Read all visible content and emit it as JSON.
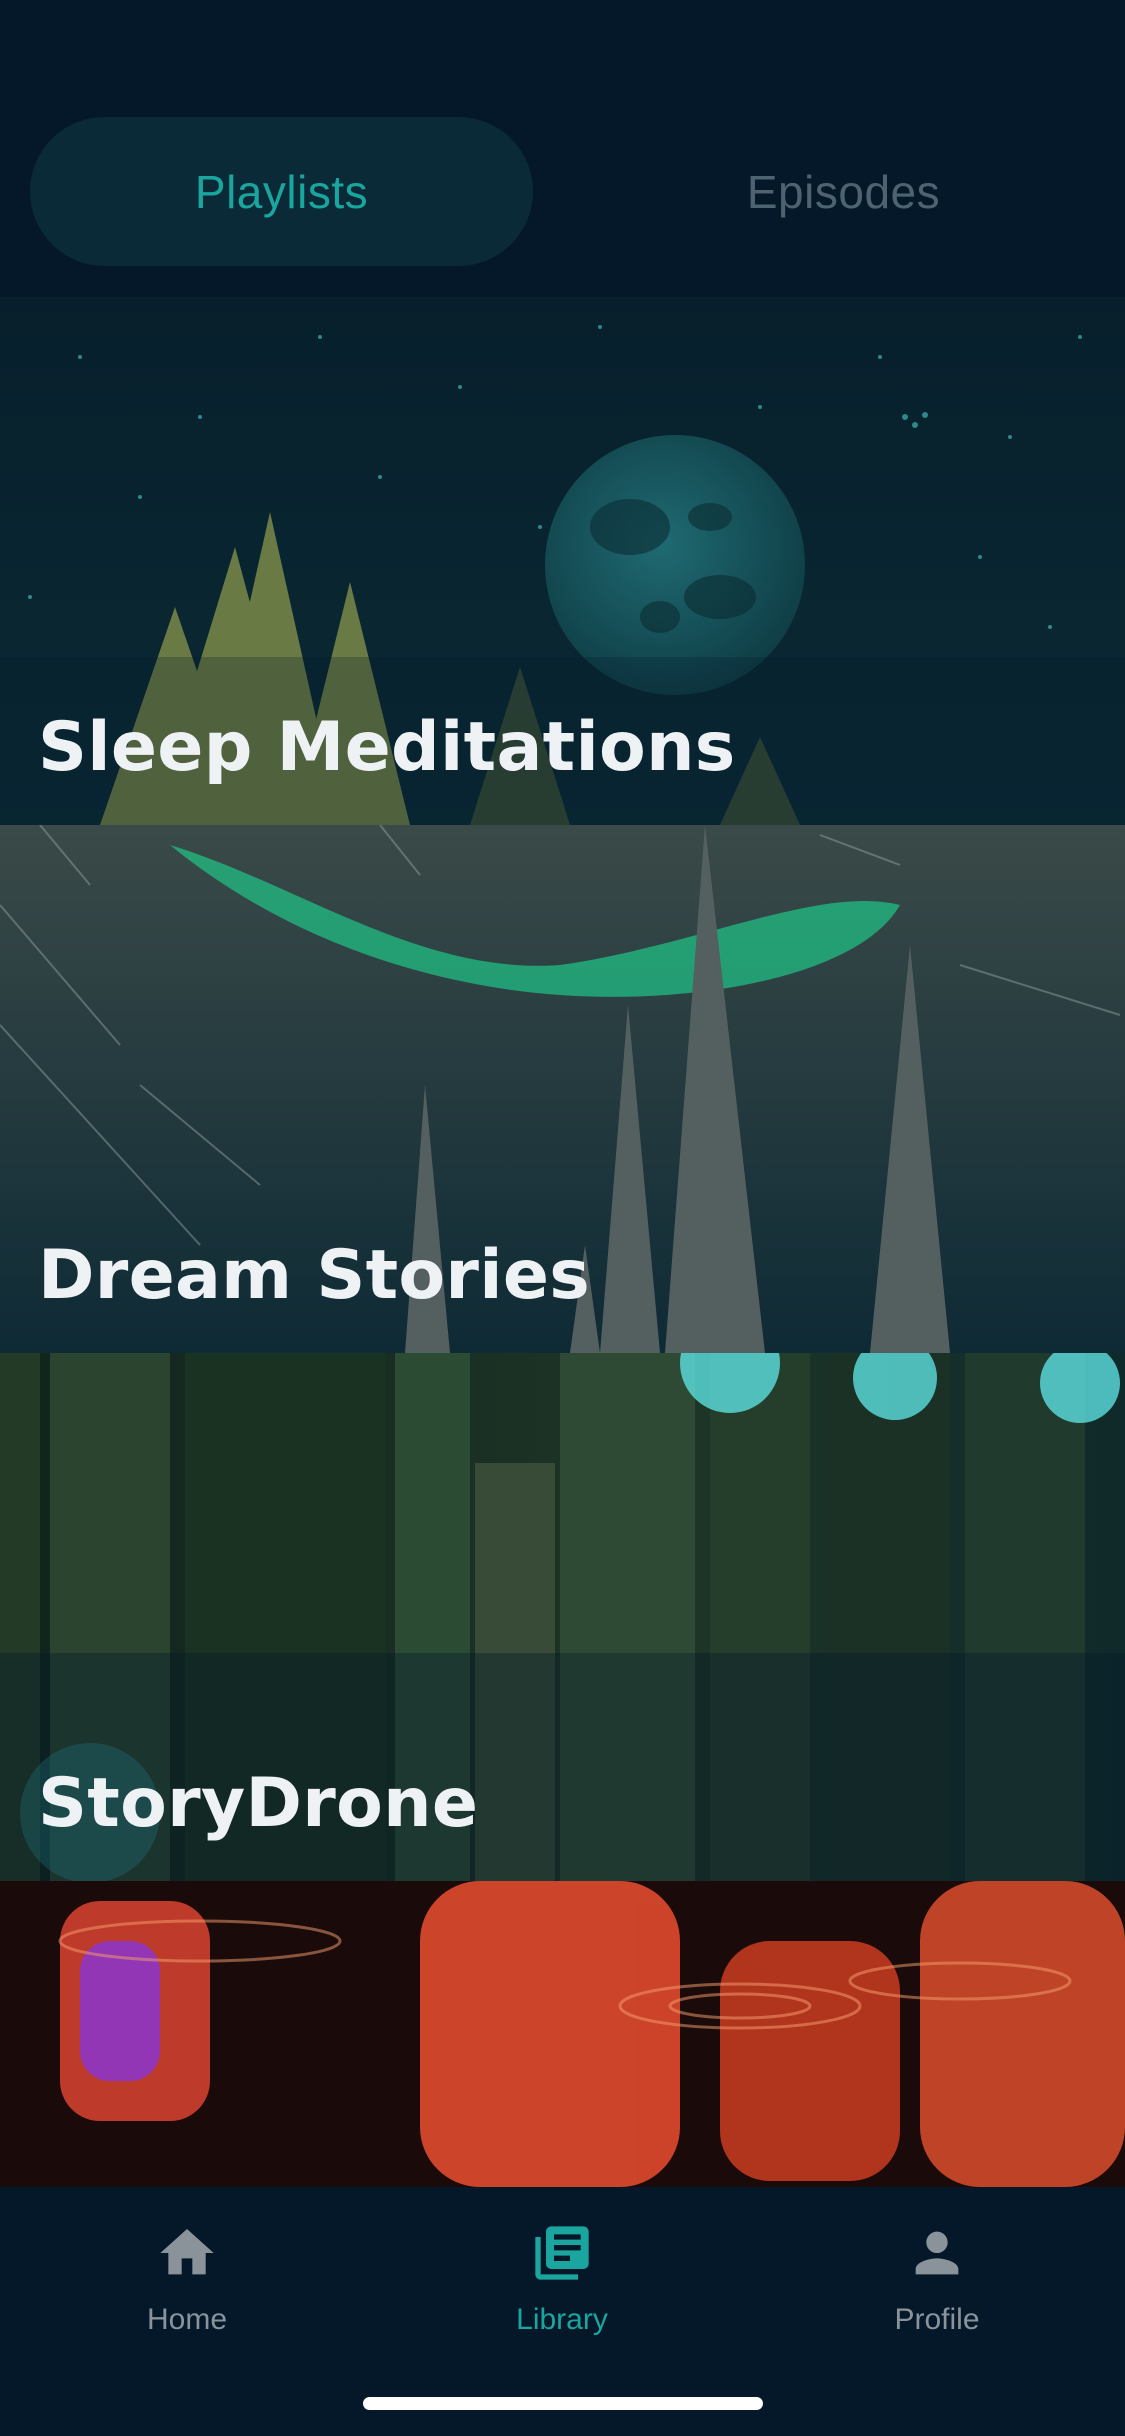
{
  "segmented": {
    "tabs": [
      {
        "label": "Playlists",
        "active": true
      },
      {
        "label": "Episodes",
        "active": false
      }
    ]
  },
  "playlists": [
    {
      "title": "Sleep Meditations",
      "image": "night-sky-moon-pine-trees"
    },
    {
      "title": "Dream Stories",
      "image": "aurora-stone-spires"
    },
    {
      "title": "StoryDrone",
      "image": "old-books-bokeh"
    },
    {
      "title": "",
      "image": "red-light-water-ripples"
    }
  ],
  "tabbar": {
    "items": [
      {
        "label": "Home",
        "icon": "home-icon",
        "active": false
      },
      {
        "label": "Library",
        "icon": "library-icon",
        "active": true
      },
      {
        "label": "Profile",
        "icon": "profile-icon",
        "active": false
      }
    ]
  },
  "colors": {
    "background": "#04182a",
    "accent": "#1aa59e",
    "inactive": "#8a9399",
    "segment_active_bg": "#0b2a38"
  }
}
